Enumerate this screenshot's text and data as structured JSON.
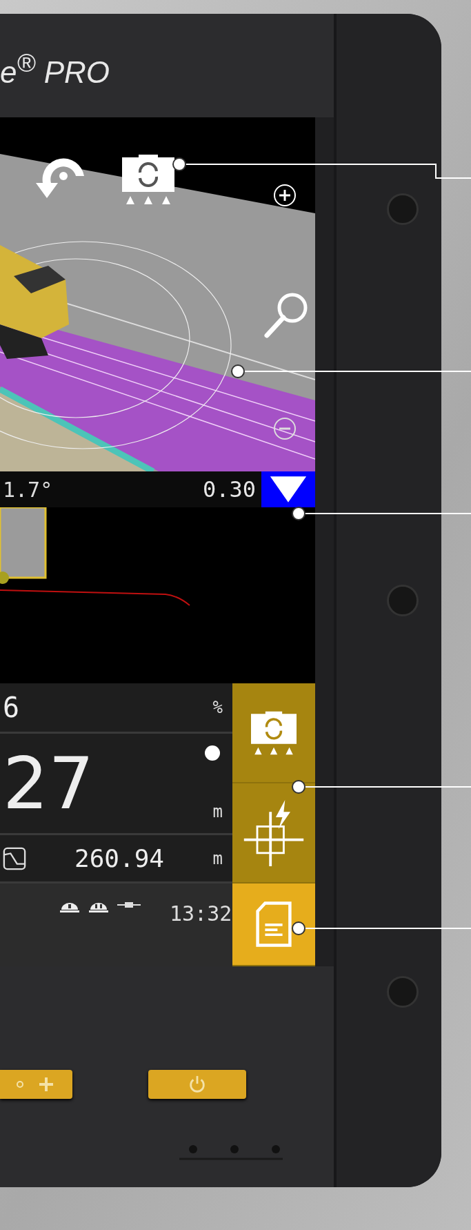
{
  "brand": {
    "text": "e$^{®}$ PRO"
  },
  "info_bar": {
    "angle": "1.7°",
    "value": "0.30"
  },
  "readouts": [
    {
      "kind": "small",
      "value": "6",
      "unit": "%"
    },
    {
      "kind": "large",
      "value": "27",
      "unit": "m"
    },
    {
      "kind": "distance",
      "value": "260.94",
      "unit": "m"
    }
  ],
  "status_bar": {
    "time": "13:32"
  },
  "side_buttons": [
    {
      "kind": "machine-sync",
      "selected": false
    },
    {
      "kind": "point-capture",
      "selected": false
    },
    {
      "kind": "document",
      "selected": true
    }
  ],
  "hardware_buttons": [
    {
      "kind": "brightness-up"
    },
    {
      "kind": "power"
    }
  ]
}
